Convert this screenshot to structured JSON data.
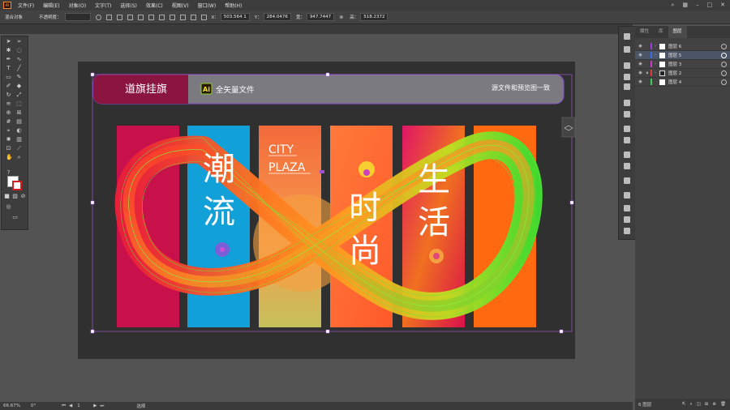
{
  "app": {
    "logo": "Ai"
  },
  "menu": [
    "文件(F)",
    "编辑(E)",
    "对象(O)",
    "文字(T)",
    "选择(S)",
    "效果(C)",
    "视图(V)",
    "窗口(W)",
    "帮助(H)"
  ],
  "control": {
    "selection": "混合对象",
    "opacity_label": "不透明度：",
    "x_label": "X：",
    "x_value": "503.564 1",
    "y_label": "Y：",
    "y_value": "284.0476",
    "w_label": "宽：",
    "w_value": "947.7447",
    "h_label": "高：",
    "h_value": "518.2372"
  },
  "banner": {
    "title": "道旗挂旗",
    "ai_badge": "Ai",
    "ai_text": "全矢量文件",
    "right_text": "源文件和预览图一致"
  },
  "poster": {
    "city": "CITY",
    "plaza": "PLAZA",
    "chao": "潮",
    "liu": "流",
    "shi": "时",
    "shang": "尚",
    "sheng": "生",
    "huo": "活"
  },
  "layers": {
    "tabs": [
      "属性",
      "库",
      "图层"
    ],
    "rows": [
      {
        "name": "图层 6",
        "color": "#9b3de0"
      },
      {
        "name": "图层 5",
        "color": "#3a6ee0"
      },
      {
        "name": "图层 3",
        "color": "#c93cc9"
      },
      {
        "name": "图层 2",
        "color": "#e03a3a"
      },
      {
        "name": "图层 4",
        "color": "#3ad05a"
      }
    ],
    "footer": "6 图层"
  },
  "status": {
    "zoom": "66.67%",
    "rotation": "0°",
    "page": "1",
    "mode": "选择"
  }
}
